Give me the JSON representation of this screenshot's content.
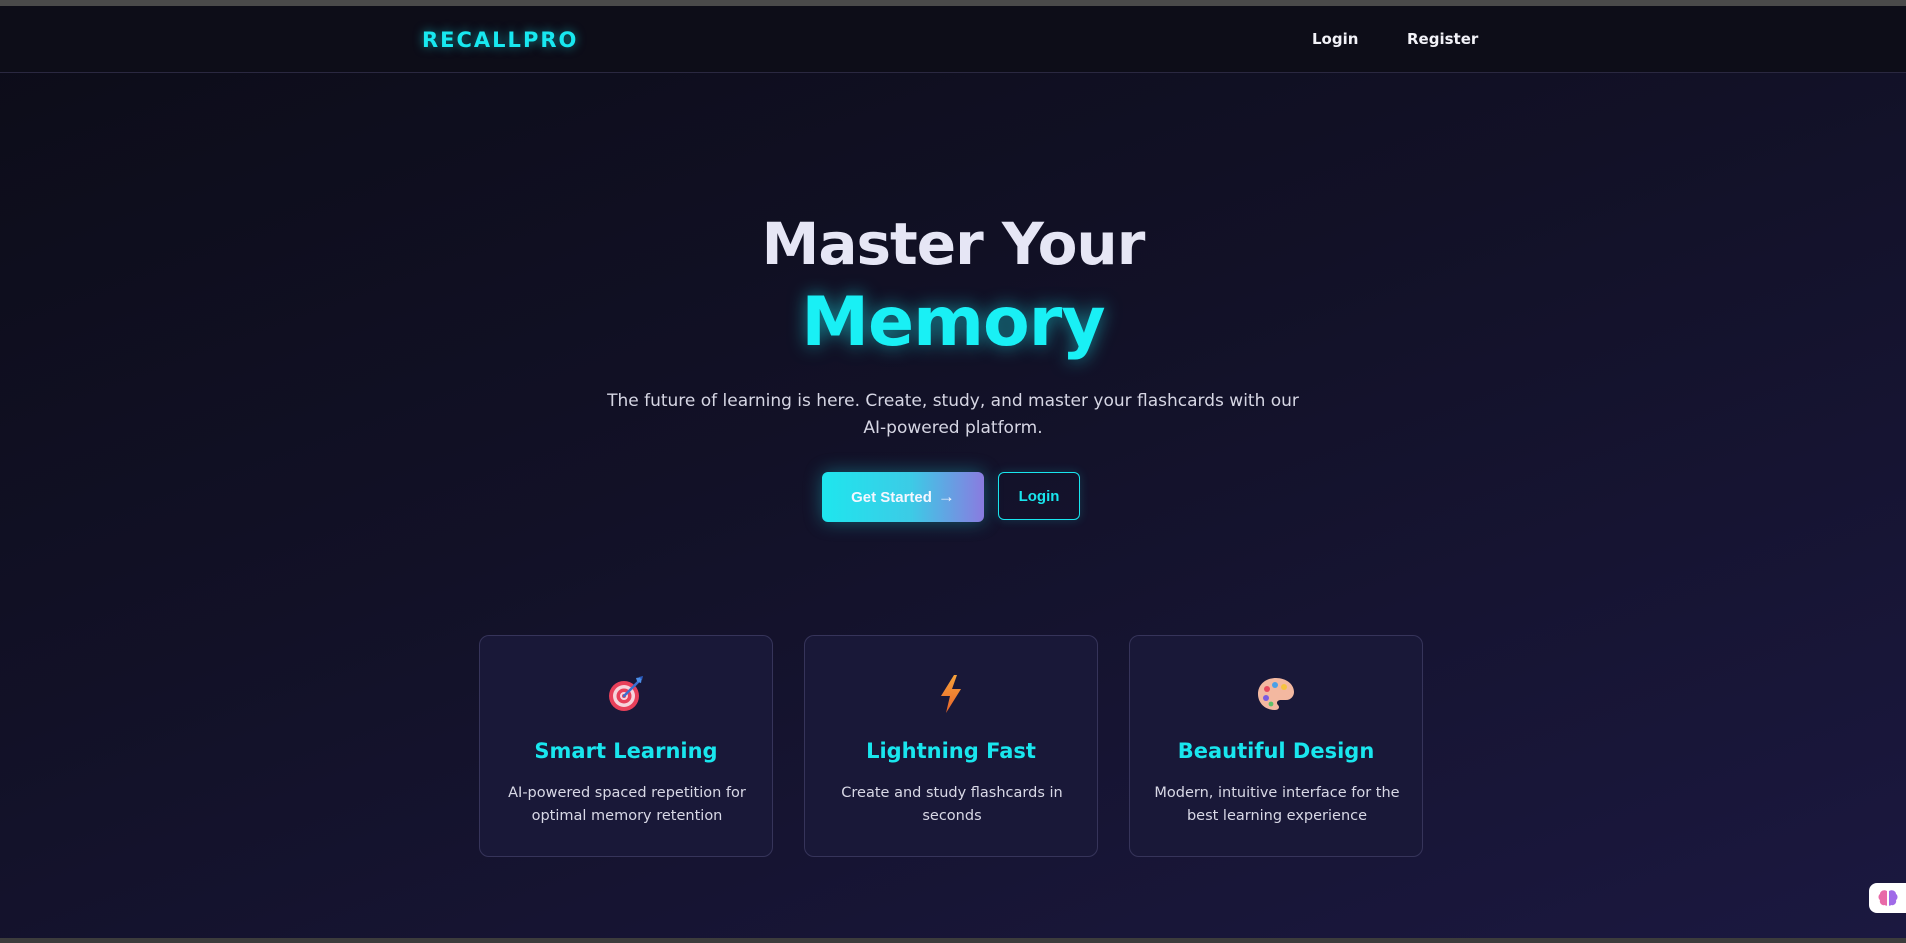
{
  "navbar": {
    "logo": "RECALLPRO",
    "login_label": "Login",
    "register_label": "Register"
  },
  "hero": {
    "title_line1": "Master Your",
    "title_line2": "Memory",
    "subtitle": "The future of learning is here. Create, study, and master your flashcards with our AI-powered platform.",
    "primary_button_label": "Get Started",
    "primary_button_arrow": "→",
    "secondary_button_label": "Login"
  },
  "features": [
    {
      "icon": "target-icon",
      "title": "Smart Learning",
      "description": "AI-powered spaced repetition for optimal memory retention"
    },
    {
      "icon": "lightning-icon",
      "title": "Lightning Fast",
      "description": "Create and study flashcards in seconds"
    },
    {
      "icon": "palette-icon",
      "title": "Beautiful Design",
      "description": "Modern, intuitive interface for the best learning experience"
    }
  ],
  "floating_widget": {
    "icon": "brain-icon"
  },
  "colors": {
    "accent": "#19e6ee",
    "background": "#121127",
    "card_background": "#191838",
    "text_primary": "#e6e6f5"
  }
}
